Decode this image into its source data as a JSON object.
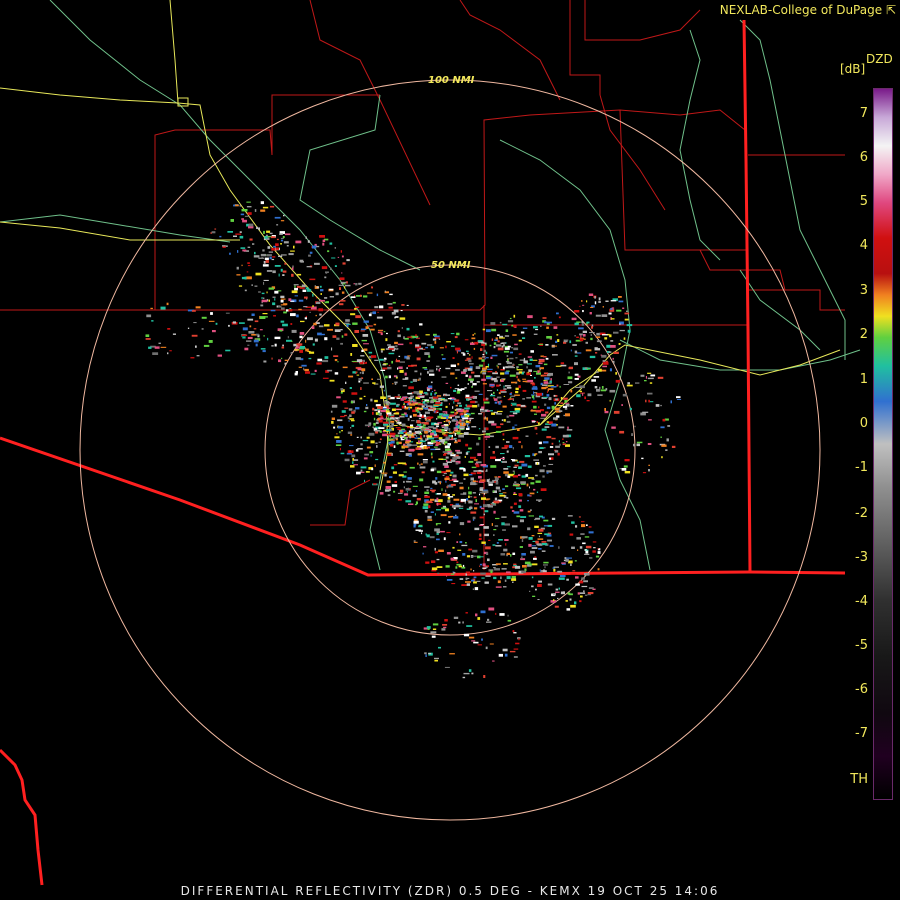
{
  "credit": "NEXLAB-College of DuPage",
  "legend": {
    "title": "DZD",
    "unit": "[dB]",
    "ticks": [
      "7",
      "6",
      "5",
      "4",
      "3",
      "2",
      "1",
      "0",
      "-1",
      "-2",
      "-3",
      "-4",
      "-5",
      "-6",
      "-7",
      "TH"
    ]
  },
  "rings": {
    "inner_label": "50 NMI",
    "outer_label": "100 NMI"
  },
  "footer": "DIFFERENTIAL REFLECTIVITY (ZDR) 0.5 DEG - KEMX 19 OCT 25 14:06",
  "colors": {
    "border": "#ff2020",
    "county": "#c01818",
    "highway": "#e8e85a",
    "river": "#6fc08a",
    "ring": "#f0b8a0",
    "accent": "#f2e85c"
  }
}
